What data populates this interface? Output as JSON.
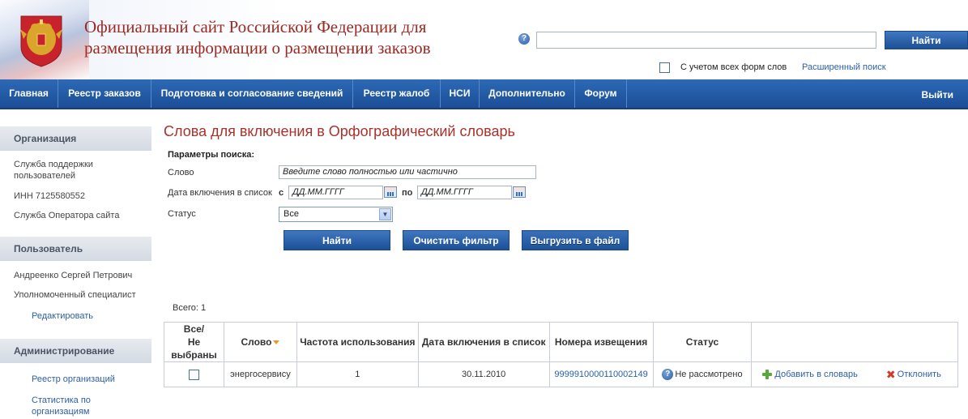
{
  "header": {
    "site_title_line1": "Официальный сайт Российской Федерации для",
    "site_title_line2": "размещения информации о размещении заказов",
    "help_icon": "?",
    "search_button": "Найти",
    "search_value": "",
    "wordforms_label": "С учетом всех форм слов",
    "advanced_search": "Расширенный поиск"
  },
  "nav": {
    "items": [
      "Главная",
      "Реестр заказов",
      "Подготовка и согласование сведений",
      "Реестр жалоб",
      "НСИ",
      "Дополнительно",
      "Форум"
    ],
    "exit": "Выйти"
  },
  "sidebar": {
    "org_title": "Организация",
    "org_support_line1": "Служба поддержки",
    "org_support_line2": "пользователей",
    "org_inn": "ИНН 7125580552",
    "org_operator": "Служба Оператора сайта",
    "user_title": "Пользователь",
    "user_name": "Андреенко Сергей Петрович",
    "user_role": "Уполномоченный специалист",
    "user_edit": "Редактировать",
    "admin_title": "Администрирование",
    "admin_registry": "Реестр организаций",
    "admin_stats_line1": "Статистика по",
    "admin_stats_line2": "организациям"
  },
  "main": {
    "title": "Слова для включения в Орфографический словарь",
    "params_label": "Параметры поиска:",
    "word_label": "Слово",
    "word_placeholder": "Введите слово полностью или частично",
    "date_label": "Дата включения в список",
    "from_label": "с",
    "to_label": "по",
    "date_from": "ДД.ММ.ГГГГ",
    "date_to": "ДД.ММ.ГГГГ",
    "status_label": "Статус",
    "status_value": "Все",
    "btn_find": "Найти",
    "btn_clear": "Очистить фильтр",
    "btn_export": "Выгрузить в файл",
    "total": "Всего: 1"
  },
  "table": {
    "col_select_line1": "Все/",
    "col_select_line2": "Не выбраны",
    "col_word": "Слово",
    "col_freq": "Частота использования",
    "col_date": "Дата включения в список",
    "col_notice": "Номера извещения",
    "col_status": "Статус",
    "rows": [
      {
        "word": "энергосервису",
        "freq": "1",
        "date": "30.11.2010",
        "notice": "9999910000110002149",
        "status": "Не рассмотрено",
        "add": "Добавить в словарь",
        "reject": "Отклонить"
      }
    ]
  },
  "colors": {
    "nav": "#1f559f",
    "title_red": "#a8322c",
    "link": "#2b5fa8"
  }
}
